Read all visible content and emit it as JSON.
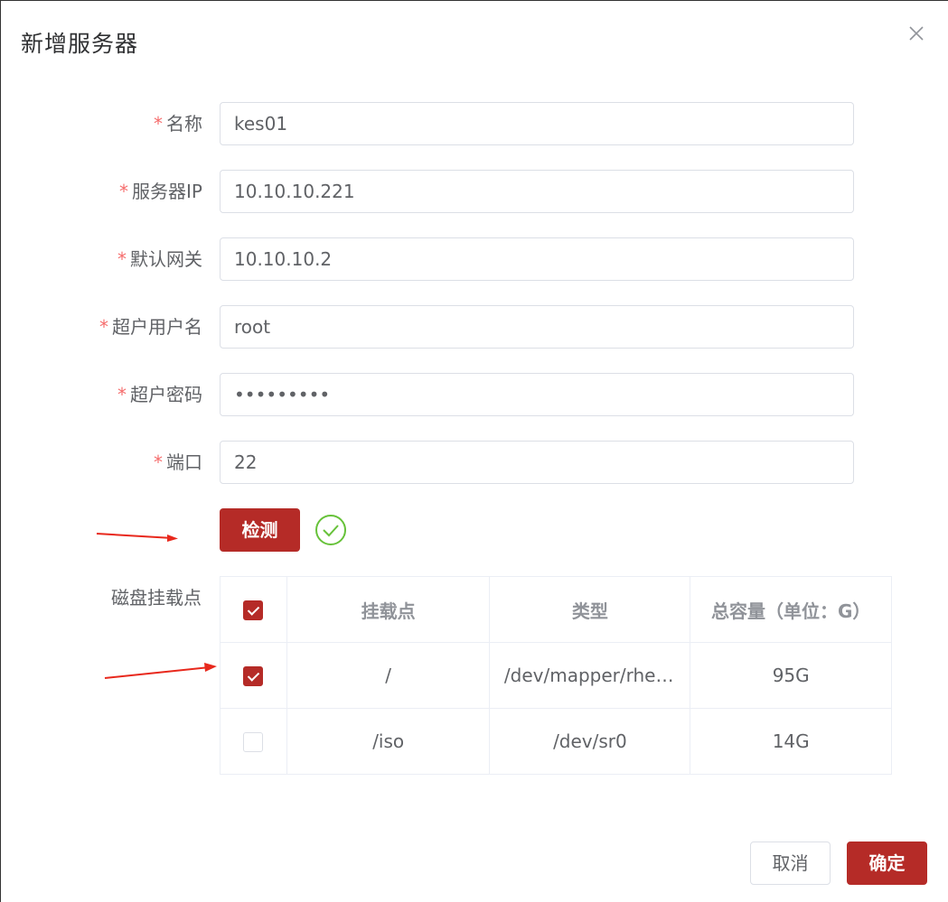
{
  "dialog": {
    "title": "新增服务器"
  },
  "form": {
    "required_mark": "*",
    "name": {
      "label": "名称",
      "value": "kes01"
    },
    "ip": {
      "label": "服务器IP",
      "value": "10.10.10.221"
    },
    "gateway": {
      "label": "默认网关",
      "value": "10.10.10.2"
    },
    "username": {
      "label": "超户用户名",
      "value": "root"
    },
    "password": {
      "label": "超户密码",
      "value": "•••••••••"
    },
    "port": {
      "label": "端口",
      "value": "22"
    },
    "check_button": "检测",
    "check_status": "success"
  },
  "disks": {
    "label": "磁盘挂载点",
    "headers": [
      "挂载点",
      "类型",
      "总容量（单位：G）"
    ],
    "rows": [
      {
        "checked": true,
        "mount": "/",
        "type": "/dev/mapper/rhel…",
        "capacity": "95G"
      },
      {
        "checked": false,
        "mount": "/iso",
        "type": "/dev/sr0",
        "capacity": "14G"
      }
    ],
    "select_all_checked": true
  },
  "footer": {
    "cancel_label": "取消",
    "confirm_label": "确定"
  },
  "colors": {
    "primary": "#b52b27",
    "success": "#67c23a",
    "required": "#f56c6c",
    "annotation_arrow": "#e8281c"
  },
  "icons": {
    "close": "close-icon",
    "check_ok": "check-circle-icon",
    "arrow": "annotation-arrow-icon"
  }
}
